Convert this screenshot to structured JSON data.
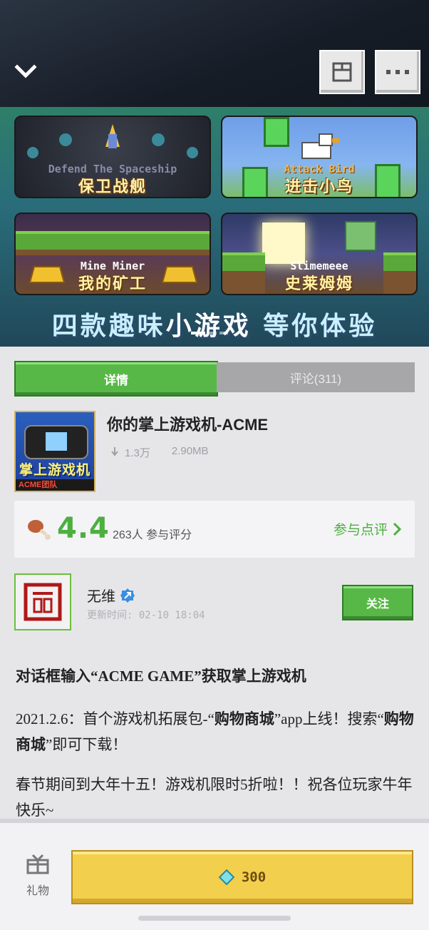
{
  "header": {
    "back_icon": "chevron-down-icon",
    "favorite_icon": "bookmark-icon",
    "more_icon": "more-icon",
    "more_label": "···"
  },
  "banner": {
    "tiles": [
      {
        "title_en": "Defend The Spaceship",
        "title_cn": "保卫战舰"
      },
      {
        "title_en": "Attack Bird",
        "title_cn": "进击小鸟"
      },
      {
        "title_en": "Mine Miner",
        "title_cn": "我的矿工"
      },
      {
        "title_en": "Slimemeee",
        "title_cn": "史莱姆姆"
      }
    ],
    "slogan_a": "四款趣味",
    "slogan_b": "小游戏",
    "slogan_c": " 等你体验"
  },
  "tabs": {
    "detail": "详情",
    "comments": "评论(311)"
  },
  "app": {
    "icon_text": "掌上游戏机",
    "icon_tag": "ACME团队",
    "name": "你的掌上游戏机-ACME",
    "downloads": "1.3万",
    "size": "2.90MB"
  },
  "rating": {
    "score": "4.4",
    "count": "263人 参与评分",
    "rate_link": "参与点评"
  },
  "author": {
    "name": "无维",
    "update_time": "更新时间: 02-10 18:04",
    "follow": "关注"
  },
  "description": {
    "heading": "对话框输入“ACME GAME”获取掌上游戏机",
    "p1_a": "2021.2.6：首个游戏机拓展包-“",
    "p1_b": "购物商城",
    "p1_c": "”app上线！搜索“",
    "p1_d": "购物商城",
    "p1_e": "”即可下载！",
    "p2": "春节期间到大年十五！游戏机限时5折啦！！祝各位玩家牛年快乐~"
  },
  "bottom": {
    "gift_label": "礼物",
    "price": "300"
  },
  "colors": {
    "green": "#58b847",
    "gold": "#f3cf4e",
    "rating_green": "#4caf3f"
  }
}
